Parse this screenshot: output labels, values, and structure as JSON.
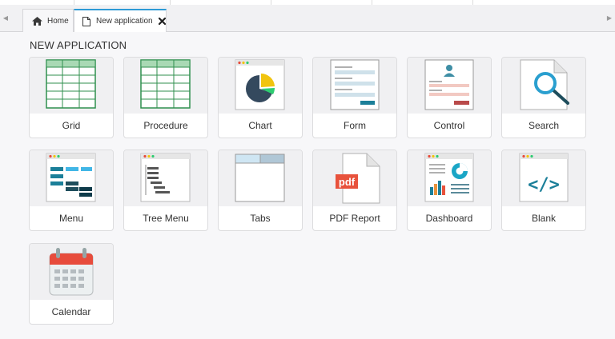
{
  "tabs": {
    "home_label": "Home",
    "active_label": "New application"
  },
  "page": {
    "title": "NEW APPLICATION"
  },
  "cards": [
    {
      "label": "Grid",
      "icon": "grid-icon"
    },
    {
      "label": "Procedure",
      "icon": "procedure-icon"
    },
    {
      "label": "Chart",
      "icon": "chart-icon"
    },
    {
      "label": "Form",
      "icon": "form-icon"
    },
    {
      "label": "Control",
      "icon": "control-icon"
    },
    {
      "label": "Search",
      "icon": "search-icon"
    },
    {
      "label": "Menu",
      "icon": "menu-icon"
    },
    {
      "label": "Tree Menu",
      "icon": "tree-menu-icon"
    },
    {
      "label": "Tabs",
      "icon": "tabs-icon"
    },
    {
      "label": "PDF Report",
      "icon": "pdf-icon",
      "icon_text": "pdf"
    },
    {
      "label": "Dashboard",
      "icon": "dashboard-icon"
    },
    {
      "label": "Blank",
      "icon": "blank-code-icon",
      "icon_text": "</>"
    },
    {
      "label": "Calendar",
      "icon": "calendar-icon"
    }
  ],
  "colors": {
    "grid_green": "#2f8f4e",
    "teal": "#1b7f99",
    "dark_navy": "#0e3b4a",
    "pdf_red": "#e8523c",
    "calendar_red": "#e74c3c",
    "tab_accent": "#2e9bd6"
  }
}
